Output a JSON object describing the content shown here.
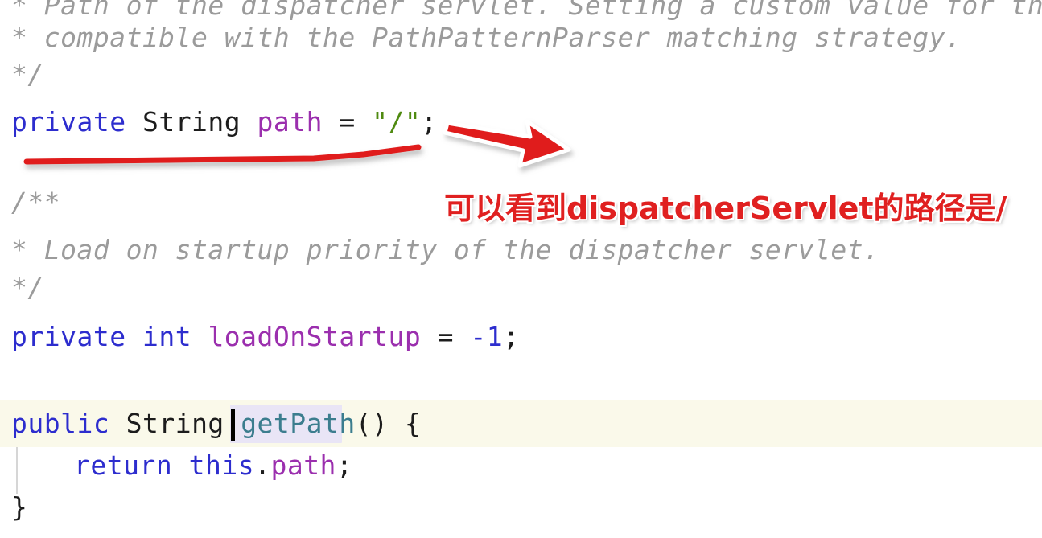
{
  "editor": {
    "background_color": "#ffffff",
    "current_line_highlight_color": "#faf9ea",
    "occurrence_highlight_color": "#e9e5f6",
    "lines": [
      {
        "id": "comment-path-of-dispatcher",
        "text": "* Path of the dispatcher servlet. Setting a custom value for thi",
        "kind": "comment"
      },
      {
        "id": "comment-compatible-pathpatternparser",
        "text": "* compatible with the PathPatternParser matching strategy.",
        "kind": "comment"
      },
      {
        "id": "comment-close-1",
        "text": "*/",
        "kind": "comment"
      },
      {
        "id": "comment-open-2",
        "text": "/**",
        "kind": "comment"
      },
      {
        "id": "comment-load-on-startup",
        "text": "* Load on startup priority of the dispatcher servlet.",
        "kind": "comment"
      },
      {
        "id": "comment-close-2",
        "text": "*/",
        "kind": "comment"
      }
    ],
    "field_path": {
      "modifier": "private",
      "type": "String",
      "name": "path",
      "equals": "=",
      "value": "\"/\"",
      "terminator": ";"
    },
    "field_load_on_startup": {
      "modifier": "private",
      "type": "int",
      "name": "loadOnStartup",
      "equals": "=",
      "value": "-1",
      "terminator": ";"
    },
    "method_get_path": {
      "modifier": "public",
      "return_type": "String",
      "name": "getPath",
      "parens": "()",
      "open_brace": "{",
      "body": {
        "return_keyword": "return",
        "this_keyword": "this",
        "dot": ".",
        "field": "path",
        "terminator": ";"
      },
      "close_brace": "}"
    }
  },
  "annotations": {
    "accent_color": "#e02020",
    "outline_color": "#ffffff",
    "underline": {
      "name": "red-underline-path-field",
      "target_line": "private String path = \"/\";"
    },
    "arrow": {
      "name": "red-arrow-pointing-right",
      "direction": "right"
    },
    "note": {
      "text": "可以看到dispatcherServlet的路径是/",
      "color": "#e02020"
    }
  }
}
